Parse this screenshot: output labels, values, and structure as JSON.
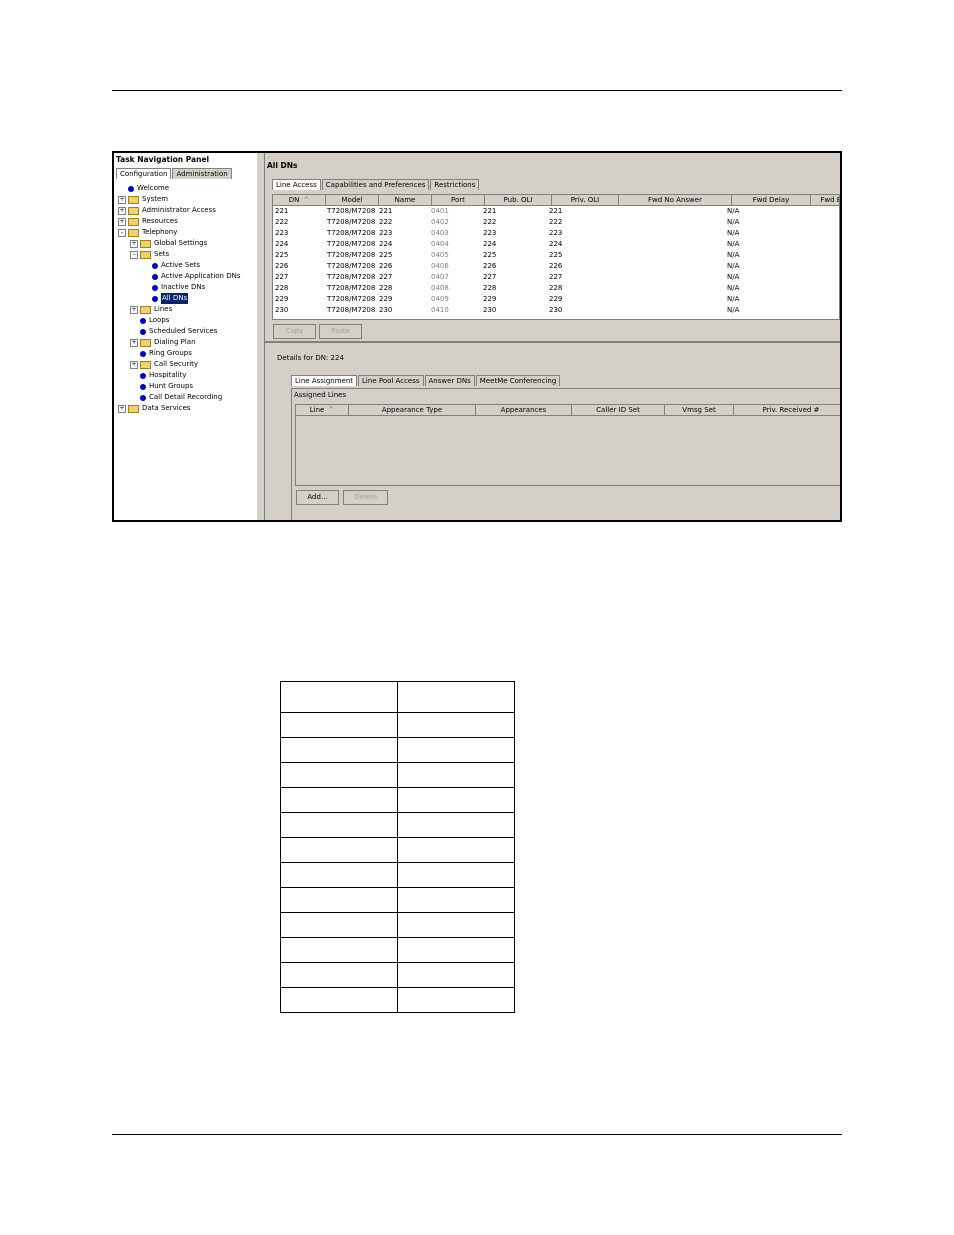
{
  "panel_title": "Task Navigation Panel",
  "left_tabs": [
    "Configuration",
    "Administration"
  ],
  "tree": [
    {
      "label": "Welcome",
      "icon": "dot-icon",
      "level": 0,
      "exp": ""
    },
    {
      "label": "System",
      "icon": "folder-icon",
      "level": 0,
      "exp": "+"
    },
    {
      "label": "Administrator Access",
      "icon": "folder-icon",
      "level": 0,
      "exp": "+"
    },
    {
      "label": "Resources",
      "icon": "folder-icon",
      "level": 0,
      "exp": "+"
    },
    {
      "label": "Telephony",
      "icon": "folder-icon",
      "level": 0,
      "exp": "-"
    },
    {
      "label": "Global Settings",
      "icon": "folder-icon",
      "level": 1,
      "exp": "+"
    },
    {
      "label": "Sets",
      "icon": "folder-icon",
      "level": 1,
      "exp": "-"
    },
    {
      "label": "Active Sets",
      "icon": "dot-icon",
      "level": 2,
      "exp": ""
    },
    {
      "label": "Active Application DNs",
      "icon": "dot-icon",
      "level": 2,
      "exp": ""
    },
    {
      "label": "Inactive DNs",
      "icon": "dot-icon",
      "level": 2,
      "exp": ""
    },
    {
      "label": "All DNs",
      "icon": "dot-icon",
      "level": 2,
      "exp": "",
      "selected": true
    },
    {
      "label": "Lines",
      "icon": "folder-icon",
      "level": 1,
      "exp": "+"
    },
    {
      "label": "Loops",
      "icon": "dot-icon",
      "level": 1,
      "exp": ""
    },
    {
      "label": "Scheduled Services",
      "icon": "dot-icon",
      "level": 1,
      "exp": ""
    },
    {
      "label": "Dialing Plan",
      "icon": "folder-icon",
      "level": 1,
      "exp": "+"
    },
    {
      "label": "Ring Groups",
      "icon": "dot-icon",
      "level": 1,
      "exp": ""
    },
    {
      "label": "Call Security",
      "icon": "folder-icon",
      "level": 1,
      "exp": "+"
    },
    {
      "label": "Hospitality",
      "icon": "dot-icon",
      "level": 1,
      "exp": ""
    },
    {
      "label": "Hunt Groups",
      "icon": "dot-icon",
      "level": 1,
      "exp": ""
    },
    {
      "label": "Call Detail Recording",
      "icon": "dot-icon",
      "level": 1,
      "exp": ""
    },
    {
      "label": "Data Services",
      "icon": "folder-icon",
      "level": 0,
      "exp": "+"
    }
  ],
  "main_title": "All DNs",
  "top_tabs": [
    "Line Access",
    "Capabilities and Preferences",
    "Restrictions"
  ],
  "dn_columns": [
    "DN",
    "Model",
    "Name",
    "Port",
    "Pub. OLI",
    "Priv. OLI",
    "Fwd No Answer",
    "Fwd Delay",
    "Fwd B"
  ],
  "dn_rows": [
    [
      "221",
      "T7208/M7208",
      "221",
      "0401",
      "221",
      "221",
      "",
      "N/A"
    ],
    [
      "222",
      "T7208/M7208",
      "222",
      "0402",
      "222",
      "222",
      "",
      "N/A"
    ],
    [
      "223",
      "T7208/M7208",
      "223",
      "0403",
      "223",
      "223",
      "",
      "N/A"
    ],
    [
      "224",
      "T7208/M7208",
      "224",
      "0404",
      "224",
      "224",
      "",
      "N/A"
    ],
    [
      "225",
      "T7208/M7208",
      "225",
      "0405",
      "225",
      "225",
      "",
      "N/A"
    ],
    [
      "226",
      "T7208/M7208",
      "226",
      "0406",
      "226",
      "226",
      "",
      "N/A"
    ],
    [
      "227",
      "T7208/M7208",
      "227",
      "0407",
      "227",
      "227",
      "",
      "N/A"
    ],
    [
      "228",
      "T7208/M7208",
      "228",
      "0408",
      "228",
      "228",
      "",
      "N/A"
    ],
    [
      "229",
      "T7208/M7208",
      "229",
      "0409",
      "229",
      "229",
      "",
      "N/A"
    ],
    [
      "230",
      "T7208/M7208",
      "230",
      "0410",
      "230",
      "230",
      "",
      "N/A"
    ]
  ],
  "copy_label": "Copy",
  "paste_label": "Paste",
  "details_title": "Details for DN: 224",
  "detail_tabs": [
    "Line Assignment",
    "Line Pool Access",
    "Answer DNs",
    "MeetMe Conferencing"
  ],
  "assigned_lines_label": "Assigned Lines",
  "assigned_columns": [
    "Line",
    "Appearance Type",
    "Appearances",
    "Caller ID Set",
    "Vmsg Set",
    "Priv. Received #"
  ],
  "add_label": "Add...",
  "delete_label": "Delete",
  "sort_indicator": "^"
}
